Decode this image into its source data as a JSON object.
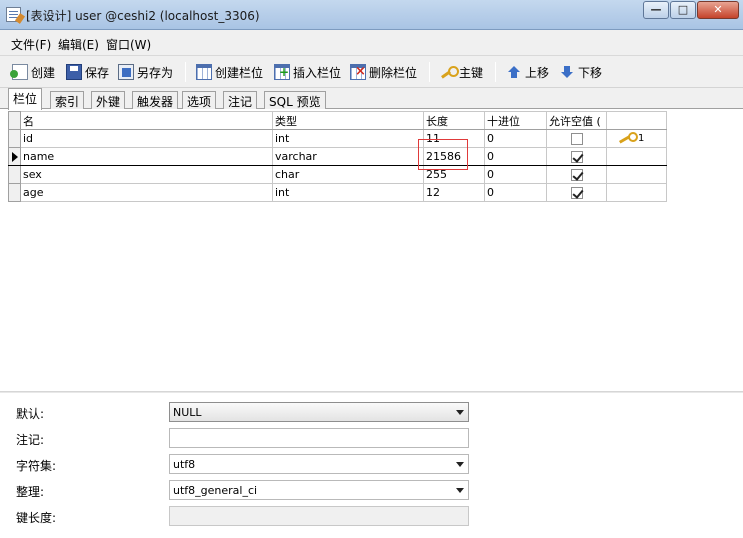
{
  "window": {
    "title": "[表设计] user @ceshi2 (localhost_3306)",
    "controls": {
      "minimize": "—",
      "maximize": "□",
      "close": "✕"
    }
  },
  "menu": [
    {
      "label": "文件(F)"
    },
    {
      "label": "编辑(E)"
    },
    {
      "label": "窗口(W)"
    }
  ],
  "toolbar": {
    "create": "创建",
    "save": "保存",
    "save_as": "另存为",
    "create_column": "创建栏位",
    "insert_column": "插入栏位",
    "delete_column": "删除栏位",
    "primary_key": "主键",
    "move_up": "上移",
    "move_down": "下移"
  },
  "tabs": [
    {
      "label": "栏位",
      "active": true
    },
    {
      "label": "索引"
    },
    {
      "label": "外键"
    },
    {
      "label": "触发器"
    },
    {
      "label": "选项"
    },
    {
      "label": "注记"
    },
    {
      "label": "SQL 预览"
    }
  ],
  "grid": {
    "headers": [
      "名",
      "类型",
      "长度",
      "十进位",
      "允许空值 (",
      ""
    ],
    "rows": [
      {
        "name": "id",
        "type": "int",
        "length": "11",
        "decimal": "0",
        "allow_null": false,
        "key": "1",
        "current": false
      },
      {
        "name": "name",
        "type": "varchar",
        "length": "21586",
        "decimal": "0",
        "allow_null": true,
        "key": "",
        "current": true
      },
      {
        "name": "sex",
        "type": "char",
        "length": "255",
        "decimal": "0",
        "allow_null": true,
        "key": "",
        "current": false
      },
      {
        "name": "age",
        "type": "int",
        "length": "12",
        "decimal": "0",
        "allow_null": true,
        "key": "",
        "current": false
      }
    ]
  },
  "properties": {
    "default_label": "默认:",
    "default_value": "NULL",
    "comment_label": "注记:",
    "comment_value": "",
    "charset_label": "字符集:",
    "charset_value": "utf8",
    "collation_label": "整理:",
    "collation_value": "utf8_general_ci",
    "key_length_label": "键长度:",
    "key_length_value": ""
  },
  "colors": {
    "highlight_box": "#e03a3a",
    "key_icon": "#d9a21b"
  }
}
